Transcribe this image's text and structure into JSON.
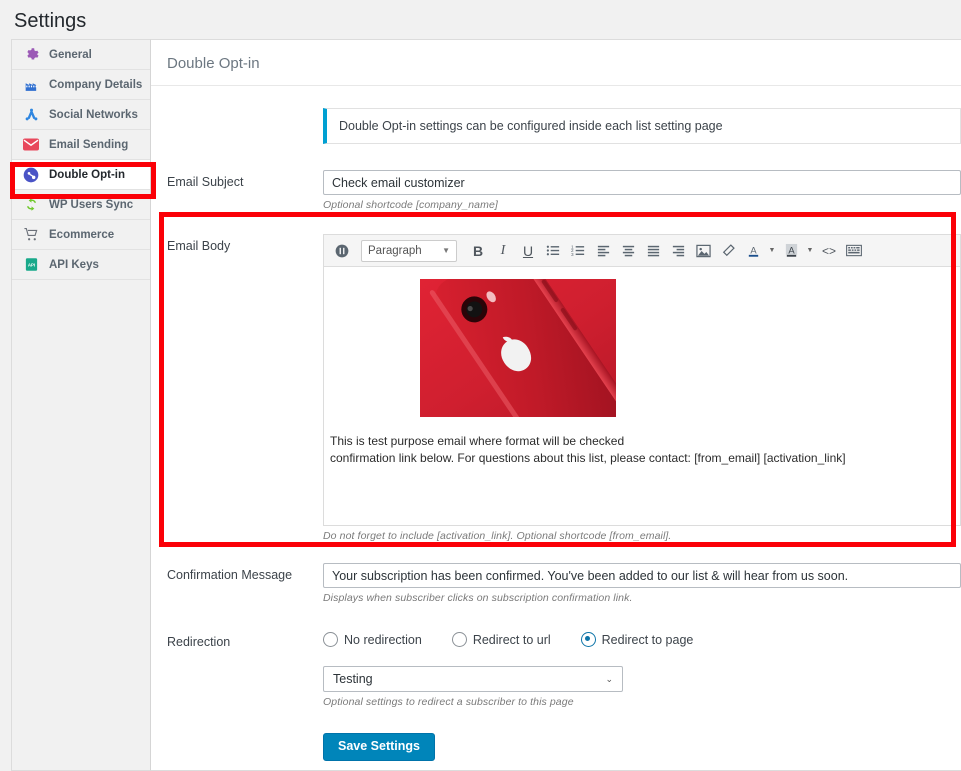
{
  "header": {
    "title": "Settings"
  },
  "sidebar": {
    "items": [
      {
        "label": "General",
        "icon": "gear-icon",
        "active": false
      },
      {
        "label": "Company Details",
        "icon": "building-icon",
        "active": false
      },
      {
        "label": "Social Networks",
        "icon": "share-network-icon",
        "active": false
      },
      {
        "label": "Email Sending",
        "icon": "envelope-icon",
        "active": false
      },
      {
        "label": "Double Opt-in",
        "icon": "double-optin-icon",
        "active": true
      },
      {
        "label": "WP Users Sync",
        "icon": "sync-refresh-icon",
        "active": false
      },
      {
        "label": "Ecommerce",
        "icon": "shopping-cart-icon",
        "active": false
      },
      {
        "label": "API Keys",
        "icon": "api-key-icon",
        "active": false
      }
    ]
  },
  "main": {
    "section_title": "Double Opt-in",
    "notice": "Double Opt-in settings can be configured inside each list setting page",
    "email_subject": {
      "label": "Email Subject",
      "value": "Check email customizer",
      "placeholder": "",
      "hint": "Optional shortcode [company_name]"
    },
    "email_body": {
      "label": "Email Body",
      "hint": "Do not forget to include [activation_link]. Optional shortcode [from_email].",
      "content_line1": "This is test purpose email where format will be checked",
      "content_line2": "confirmation link below. For questions about this list, please contact: [from_email] [activation_link]",
      "image_alt": "red-iphone-product-photo",
      "toolbar": {
        "style_select": "Paragraph",
        "buttons": [
          {
            "name": "toggle-toolbar-icon",
            "glyph": "❰❱"
          },
          {
            "name": "bold-icon",
            "glyph": "B"
          },
          {
            "name": "italic-icon",
            "glyph": "I"
          },
          {
            "name": "underline-icon",
            "glyph": "U"
          },
          {
            "name": "bulleted-list-icon",
            "glyph": ""
          },
          {
            "name": "numbered-list-icon",
            "glyph": ""
          },
          {
            "name": "align-left-icon",
            "glyph": ""
          },
          {
            "name": "align-center-icon",
            "glyph": ""
          },
          {
            "name": "align-justify-icon",
            "glyph": ""
          },
          {
            "name": "align-right-icon",
            "glyph": ""
          },
          {
            "name": "insert-image-icon",
            "glyph": ""
          },
          {
            "name": "clear-formatting-icon",
            "glyph": ""
          },
          {
            "name": "text-color-icon",
            "glyph": "A"
          },
          {
            "name": "background-color-icon",
            "glyph": "A"
          },
          {
            "name": "source-code-icon",
            "glyph": "<>"
          },
          {
            "name": "keyboard-shortcuts-icon",
            "glyph": ""
          }
        ]
      }
    },
    "confirmation_message": {
      "label": "Confirmation Message",
      "value": "Your subscription has been confirmed. You've been added to our list & will hear from us soon.",
      "hint": "Displays when subscriber clicks on subscription confirmation link."
    },
    "redirection": {
      "label": "Redirection",
      "options": [
        {
          "label": "No redirection",
          "selected": false
        },
        {
          "label": "Redirect to url",
          "selected": false
        },
        {
          "label": "Redirect to page",
          "selected": true
        }
      ],
      "page_select_value": "Testing",
      "hint": "Optional settings to redirect a subscriber to this page"
    },
    "save_button": "Save Settings"
  },
  "annotations": {
    "color": "#fb0007",
    "boxes": [
      {
        "name": "highlight-sidebar-double-optin"
      },
      {
        "name": "highlight-email-body"
      }
    ]
  }
}
